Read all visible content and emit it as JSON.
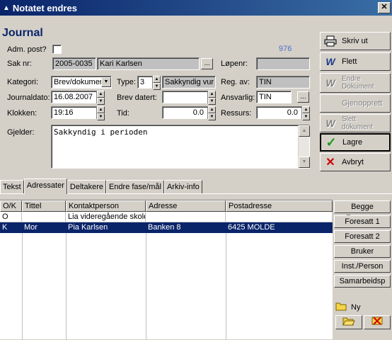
{
  "window": {
    "title": "Notatet endres",
    "close_label": "✕"
  },
  "form": {
    "section_title": "Journal",
    "adm_post_label": "Adm. post?",
    "record_number": "976",
    "sak_nr_label": "Sak nr:",
    "sak_nr_value": "2005-0035",
    "sak_name_value": "Kari Karlsen",
    "lopenr_label": "Løpenr:",
    "lopenr_value": "",
    "kategori_label": "Kategori:",
    "kategori_value": "Brev/dokumen",
    "type_label": "Type:",
    "type_value": "3",
    "type_desc_value": "Sakkyndig vur",
    "reg_av_label": "Reg. av:",
    "reg_av_value": "TIN",
    "journaldato_label": "Journaldato:",
    "journaldato_value": "16.08.2007",
    "brev_datert_label": "Brev datert:",
    "brev_datert_value": "",
    "ansvarlig_label": "Ansvarlig:",
    "ansvarlig_value": "TIN",
    "klokken_label": "Klokken:",
    "klokken_value": "19:16",
    "tid_label": "Tid:",
    "tid_value": "0.0",
    "ressurs_label": "Ressurs:",
    "ressurs_value": "0.0",
    "gjelder_label": "Gjelder:",
    "gjelder_value": "Sakkyndig i perioden",
    "ellipsis": "..."
  },
  "actions": {
    "skriv_ut": "Skriv ut",
    "flett": "Flett",
    "endre_dokument_1": "Endre",
    "endre_dokument_2": "Dokument",
    "gjenopprett": "Gjenopprett",
    "slett_dokument_1": "Slett",
    "slett_dokument_2": "dokument",
    "lagre": "Lagre",
    "avbryt": "Avbryt"
  },
  "tabs": [
    {
      "label": "Tekst"
    },
    {
      "label": "Adressater"
    },
    {
      "label": "Deltakere"
    },
    {
      "label": "Endre fase/mål"
    },
    {
      "label": "Arkiv-info"
    }
  ],
  "grid": {
    "headers": [
      "O/K",
      "Tittel",
      "Kontaktperson",
      "Adresse",
      "Postadresse"
    ],
    "rows": [
      [
        "O",
        "",
        "Lia videregående skole",
        "",
        ""
      ],
      [
        "K",
        "Mor",
        "Pia Karlsen",
        "Banken 8",
        "6425 MOLDE"
      ]
    ]
  },
  "side_buttons": {
    "begge_foresatte": "Begge Foresatte",
    "foresatt_1": "Foresatt 1",
    "foresatt_2": "Foresatt 2",
    "bruker": "Bruker",
    "inst_person": "Inst./Person",
    "samarbeidsp": "Samarbeidsp",
    "ny": "Ny"
  },
  "colors": {
    "titlebar": "#0a246a",
    "selection": "#0a246a",
    "section_title": "#0a246a"
  }
}
